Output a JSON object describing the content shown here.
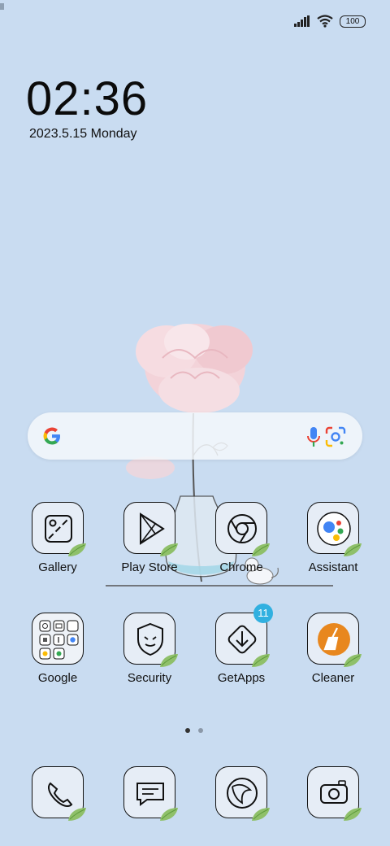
{
  "status_bar": {
    "battery": "100",
    "icons": [
      "signal-icon",
      "wifi-icon",
      "battery-icon"
    ]
  },
  "clock": {
    "time": "02:36",
    "date": "2023.5.15 Monday"
  },
  "search_bar": {
    "icons": [
      "google-logo-icon",
      "microphone-icon",
      "lens-icon"
    ]
  },
  "apps_row1": [
    {
      "label": "Gallery",
      "icon": "gallery-icon"
    },
    {
      "label": "Play Store",
      "icon": "play-store-icon"
    },
    {
      "label": "Chrome",
      "icon": "chrome-icon"
    },
    {
      "label": "Assistant",
      "icon": "assistant-icon"
    }
  ],
  "apps_row2": [
    {
      "label": "Google",
      "icon": "google-folder-icon"
    },
    {
      "label": "Security",
      "icon": "security-icon"
    },
    {
      "label": "GetApps",
      "icon": "getapps-icon",
      "badge": "11"
    },
    {
      "label": "Cleaner",
      "icon": "cleaner-icon"
    }
  ],
  "page_indicator": {
    "pages": 2,
    "current": 1
  },
  "dock": [
    {
      "icon": "phone-icon"
    },
    {
      "icon": "messages-icon"
    },
    {
      "icon": "browser-icon"
    },
    {
      "icon": "camera-icon"
    }
  ],
  "colors": {
    "background": "#c9dcf1",
    "badge": "#31b0e0",
    "leaf": "#8fc06a",
    "cleaner_orange": "#e8871e"
  }
}
